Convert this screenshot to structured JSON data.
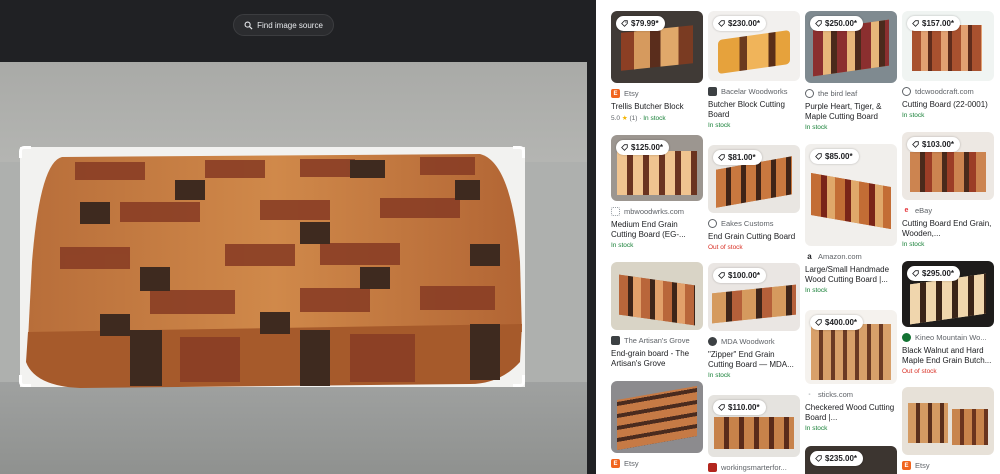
{
  "viewer": {
    "find_source_label": "Find image source"
  },
  "results": [
    {
      "price": "$79.99*",
      "source": "Etsy",
      "favicon": "etsy-icon",
      "title": "Trellis Butcher Block",
      "rating": "5.0",
      "reviews": "(1)",
      "stock": "In stock"
    },
    {
      "price": "$230.00*",
      "source": "Bacelar Woodworks",
      "favicon": "bacelar-icon",
      "title": "Butcher Block Cutting Board",
      "stock": "In stock"
    },
    {
      "price": "$250.00*",
      "source": "the bird leaf",
      "favicon": "globe-icon",
      "title": "Purple Heart, Tiger, & Maple Cutting Board",
      "stock": "In stock"
    },
    {
      "price": "$157.00*",
      "source": "tdcwoodcraft.com",
      "favicon": "globe-icon",
      "title": "Cutting Board (22-0001)",
      "stock": "In stock"
    },
    {
      "price": "$125.00*",
      "source": "mbwoodwrks.com",
      "favicon": "dots-icon",
      "title": "Medium End Grain Cutting Board (EG-...",
      "stock": "In stock"
    },
    {
      "price": "$81.00*",
      "source": "Eakes Customs",
      "favicon": "globe-icon",
      "title": "End Grain Cutting Board",
      "stock": "Out of stock",
      "stock_out": true
    },
    {
      "price": "$85.00*",
      "source": "Amazon.com",
      "favicon": "amazon-icon",
      "title": "Large/Small Handmade Wood Cutting Board |...",
      "stock": "In stock"
    },
    {
      "price": "$103.00*",
      "source": "eBay",
      "favicon": "ebay-icon",
      "title": "Cutting Board End Grain, Wooden,...",
      "stock": "In stock"
    },
    {
      "price": "",
      "source": "The Artisan's Grove",
      "favicon": "artisan-icon",
      "title": "End-grain board - The Artisan's Grove",
      "stock": ""
    },
    {
      "price": "$100.00*",
      "source": "MDA Woodwork",
      "favicon": "mda-icon",
      "title": "\"Zipper\" End Grain Cutting Board — MDA...",
      "stock": "In stock"
    },
    {
      "price": "$400.00*",
      "source": "sticks.com",
      "favicon": "sticks-icon",
      "title": "Checkered Wood Cutting Board |...",
      "stock": "In stock"
    },
    {
      "price": "$295.00*",
      "source": "Kineo Mountain Wo...",
      "favicon": "kineo-icon",
      "title": "Black Walnut and Hard Maple End Grain Butch...",
      "stock": "Out of stock",
      "stock_out": true
    },
    {
      "price": "",
      "source": "Etsy",
      "favicon": "etsy-icon",
      "title": "",
      "stock": ""
    },
    {
      "price": "$110.00*",
      "source": "workingsmarterfor...",
      "favicon": "ws-icon",
      "title": "",
      "stock": ""
    },
    {
      "price": "$235.00*",
      "source": "",
      "favicon": "",
      "title": "",
      "stock": ""
    },
    {
      "price": "",
      "source": "Etsy",
      "favicon": "etsy-icon",
      "title": "",
      "stock": ""
    }
  ],
  "colors": {
    "viewer_bg": "#202124",
    "in_stock": "#188038",
    "out_of_stock": "#d93025",
    "etsy": "#f1641e"
  }
}
